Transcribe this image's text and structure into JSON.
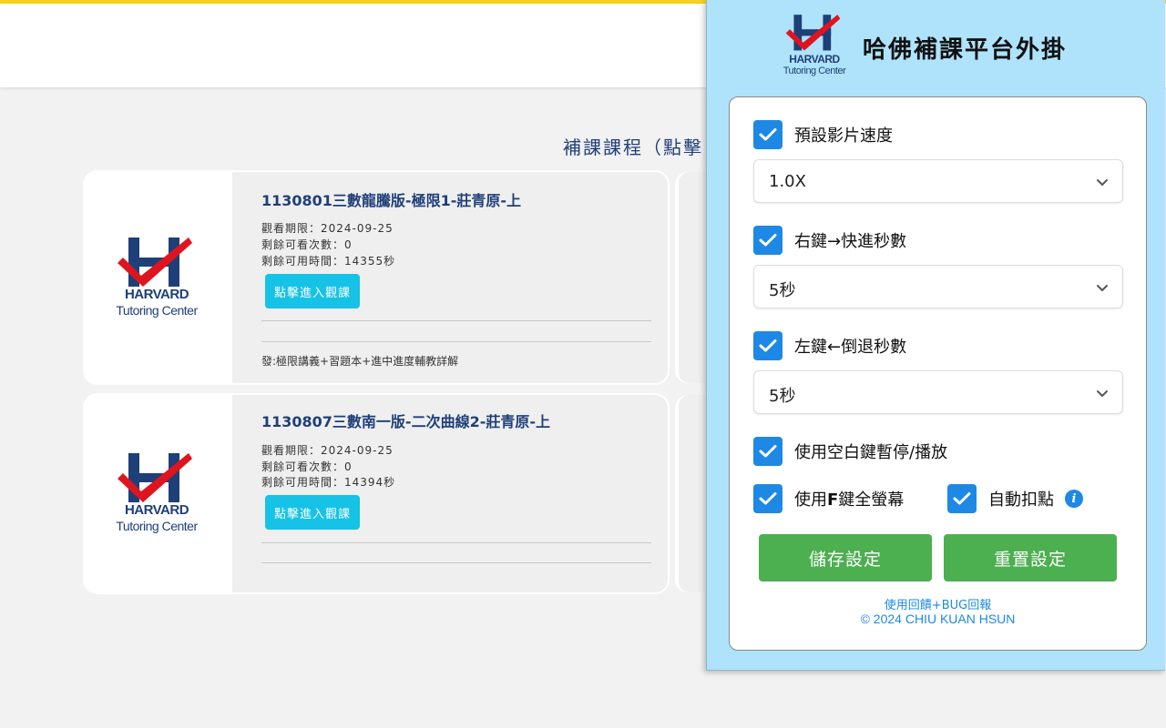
{
  "page": {
    "section_title": "補課課程（點擊"
  },
  "courses": [
    {
      "title": "1130801三數龍騰版-極限1-莊青原-上",
      "deadline": "觀看期限：2024-09-25",
      "remaining_views": "剩餘可看次數：0",
      "remaining_time": "剩餘可用時間：14355秒",
      "button": "點擊進入觀課",
      "note": "發:極限講義+習題本+進中進度輔教詳解"
    },
    {
      "title": "1130807三數南一版-二次曲線2-莊青原-上",
      "deadline": "觀看期限：2024-09-25",
      "remaining_views": "剩餘可看次數：0",
      "remaining_time": "剩餘可用時間：14394秒",
      "button": "點擊進入觀課",
      "note": ""
    }
  ],
  "logo": {
    "word": "HARVARD",
    "sub": "Tutoring Center"
  },
  "popup": {
    "title": "哈佛補課平台外掛",
    "speed": {
      "label": "預設影片速度",
      "value": "1.0X"
    },
    "forward": {
      "label": "右鍵→快進秒數",
      "value": "5秒"
    },
    "backward": {
      "label": "左鍵←倒退秒數",
      "value": "5秒"
    },
    "space": {
      "label": "使用空白鍵暫停/播放"
    },
    "fullscreen": {
      "label_prefix": "使用",
      "label_key": "F",
      "label_suffix": "鍵全螢幕"
    },
    "auto": {
      "label": "自動扣點"
    },
    "info_glyph": "i",
    "save_button": "儲存設定",
    "reset_button": "重置設定",
    "feedback_link": "使用回饋+BUG回報",
    "copyright": "© 2024 CHIU KUAN HSUN"
  },
  "colors": {
    "accent_blue": "#1e88e5",
    "popup_bg": "#aee3fb",
    "green": "#4caf50",
    "cyan_button": "#16c2e6",
    "brand_navy": "#1f3f78",
    "brand_red": "#e0141e"
  }
}
